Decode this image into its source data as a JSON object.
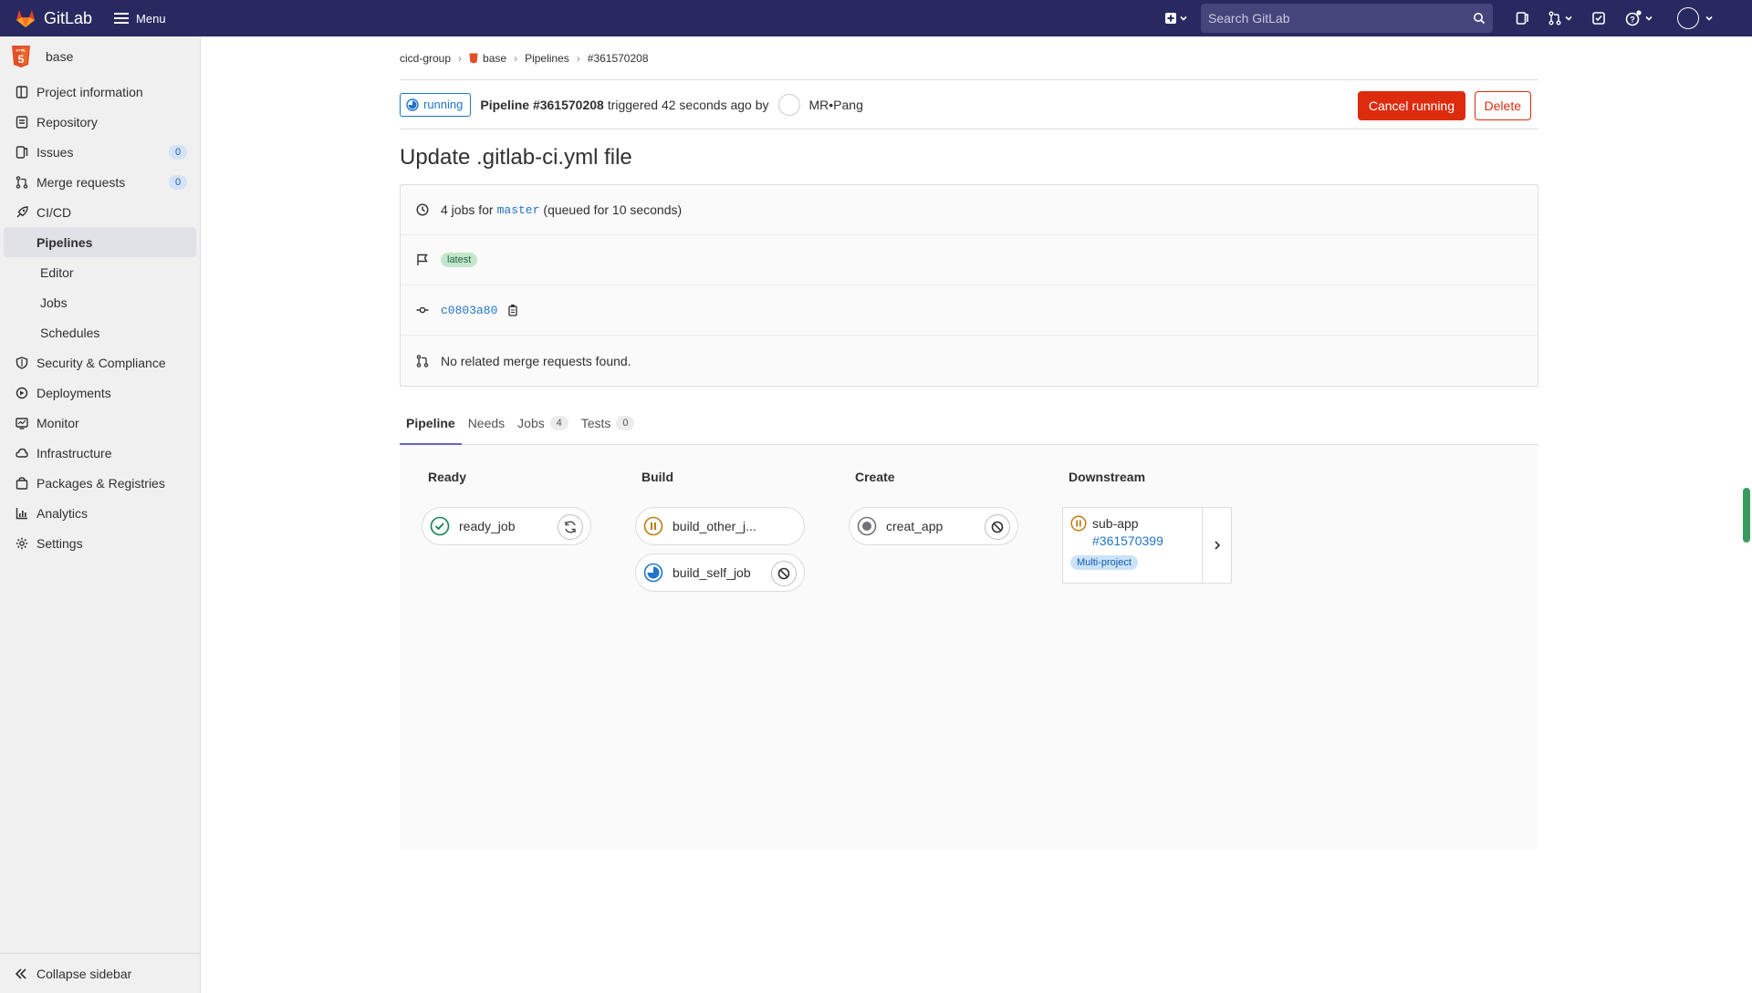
{
  "topbar": {
    "app_name": "GitLab",
    "menu_label": "Menu",
    "search_placeholder": "Search GitLab"
  },
  "sidebar": {
    "project_name": "base",
    "items": [
      {
        "label": "Project information",
        "icon": "project-info-icon"
      },
      {
        "label": "Repository",
        "icon": "repository-icon"
      },
      {
        "label": "Issues",
        "icon": "issues-icon",
        "badge": "0"
      },
      {
        "label": "Merge requests",
        "icon": "merge-request-icon",
        "badge": "0"
      },
      {
        "label": "CI/CD",
        "icon": "rocket-icon"
      }
    ],
    "cicd_sub": [
      "Pipelines",
      "Editor",
      "Jobs",
      "Schedules"
    ],
    "items_after": [
      {
        "label": "Security & Compliance",
        "icon": "shield-icon"
      },
      {
        "label": "Deployments",
        "icon": "deployments-icon"
      },
      {
        "label": "Monitor",
        "icon": "monitor-icon"
      },
      {
        "label": "Infrastructure",
        "icon": "cloud-icon"
      },
      {
        "label": "Packages & Registries",
        "icon": "package-icon"
      },
      {
        "label": "Analytics",
        "icon": "chart-icon"
      },
      {
        "label": "Settings",
        "icon": "gear-icon"
      }
    ],
    "collapse_label": "Collapse sidebar"
  },
  "breadcrumb": [
    "cicd-group",
    "base",
    "Pipelines",
    "#361570208"
  ],
  "pipeline_header": {
    "status": "running",
    "pipeline_label": "Pipeline #361570208",
    "triggered_text": "triggered 42 seconds ago by",
    "user": "MR•Pang",
    "cancel_label": "Cancel running",
    "delete_label": "Delete"
  },
  "title": "Update .gitlab-ci.yml file",
  "info": {
    "jobs_prefix": "4 jobs for",
    "branch": "master",
    "jobs_suffix": "(queued for 10 seconds)",
    "latest_badge": "latest",
    "commit_sha": "c0803a80",
    "mr_text": "No related merge requests found."
  },
  "tabs": [
    {
      "label": "Pipeline"
    },
    {
      "label": "Needs"
    },
    {
      "label": "Jobs",
      "count": "4"
    },
    {
      "label": "Tests",
      "count": "0"
    }
  ],
  "stages": [
    {
      "name": "Ready",
      "jobs": [
        {
          "name": "ready_job",
          "status": "success",
          "action": "retry"
        }
      ]
    },
    {
      "name": "Build",
      "jobs": [
        {
          "name": "build_other_j...",
          "status": "manual-paused",
          "action": ""
        },
        {
          "name": "build_self_job",
          "status": "running",
          "action": "cancel"
        }
      ]
    },
    {
      "name": "Create",
      "jobs": [
        {
          "name": "creat_app",
          "status": "created",
          "action": "cancel"
        }
      ]
    },
    {
      "name": "Downstream",
      "downstream": {
        "name": "sub-app",
        "id": "#361570399",
        "badge": "Multi-project",
        "status": "paused"
      }
    }
  ],
  "colors": {
    "topbar": "#292961",
    "running": "#1f75cb",
    "success": "#108548",
    "paused": "#c17d10",
    "danger": "#dd2b0e"
  }
}
